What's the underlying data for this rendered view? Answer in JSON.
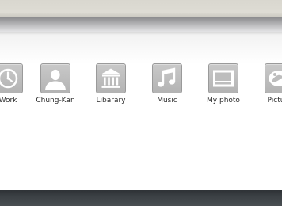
{
  "icons": [
    {
      "label": "Work",
      "icon": "clock-icon"
    },
    {
      "label": "Chung-Kan",
      "icon": "person-icon"
    },
    {
      "label": "Libarary",
      "icon": "library-icon"
    },
    {
      "label": "Music",
      "icon": "music-note-icon"
    },
    {
      "label": "My photo",
      "icon": "photo-frame-icon"
    },
    {
      "label": "Picture",
      "icon": "picture-icon"
    }
  ],
  "colors": {
    "icon_tile": "#bdbdbd",
    "icon_glyph": "#ffffff",
    "label_text": "#2a2a2a",
    "panel_background": "#ffffff",
    "bottom_bar": "#3b4044"
  }
}
